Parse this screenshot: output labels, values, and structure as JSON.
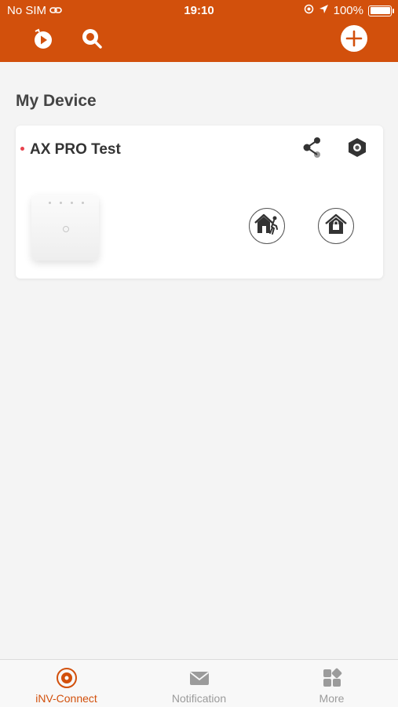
{
  "status_bar": {
    "carrier": "No SIM",
    "time": "19:10",
    "battery": "100%"
  },
  "header": {
    "icons": [
      "playback-icon",
      "search-icon",
      "add-icon"
    ]
  },
  "main": {
    "title": "My Device",
    "devices": [
      {
        "name": "AX PRO Test",
        "status_color": "#e8424d",
        "actions": [
          "share-icon",
          "settings-icon"
        ],
        "modes": [
          "away-arm-icon",
          "stay-arm-icon"
        ]
      }
    ]
  },
  "tabbar": {
    "tabs": [
      {
        "label": "iNV-Connect",
        "icon": "inv-connect-icon",
        "active": true
      },
      {
        "label": "Notification",
        "icon": "mail-icon",
        "active": false
      },
      {
        "label": "More",
        "icon": "grid-icon",
        "active": false
      }
    ]
  },
  "colors": {
    "brand": "#d2500c",
    "background": "#f4f4f4",
    "inactive": "#9b9b9b"
  }
}
